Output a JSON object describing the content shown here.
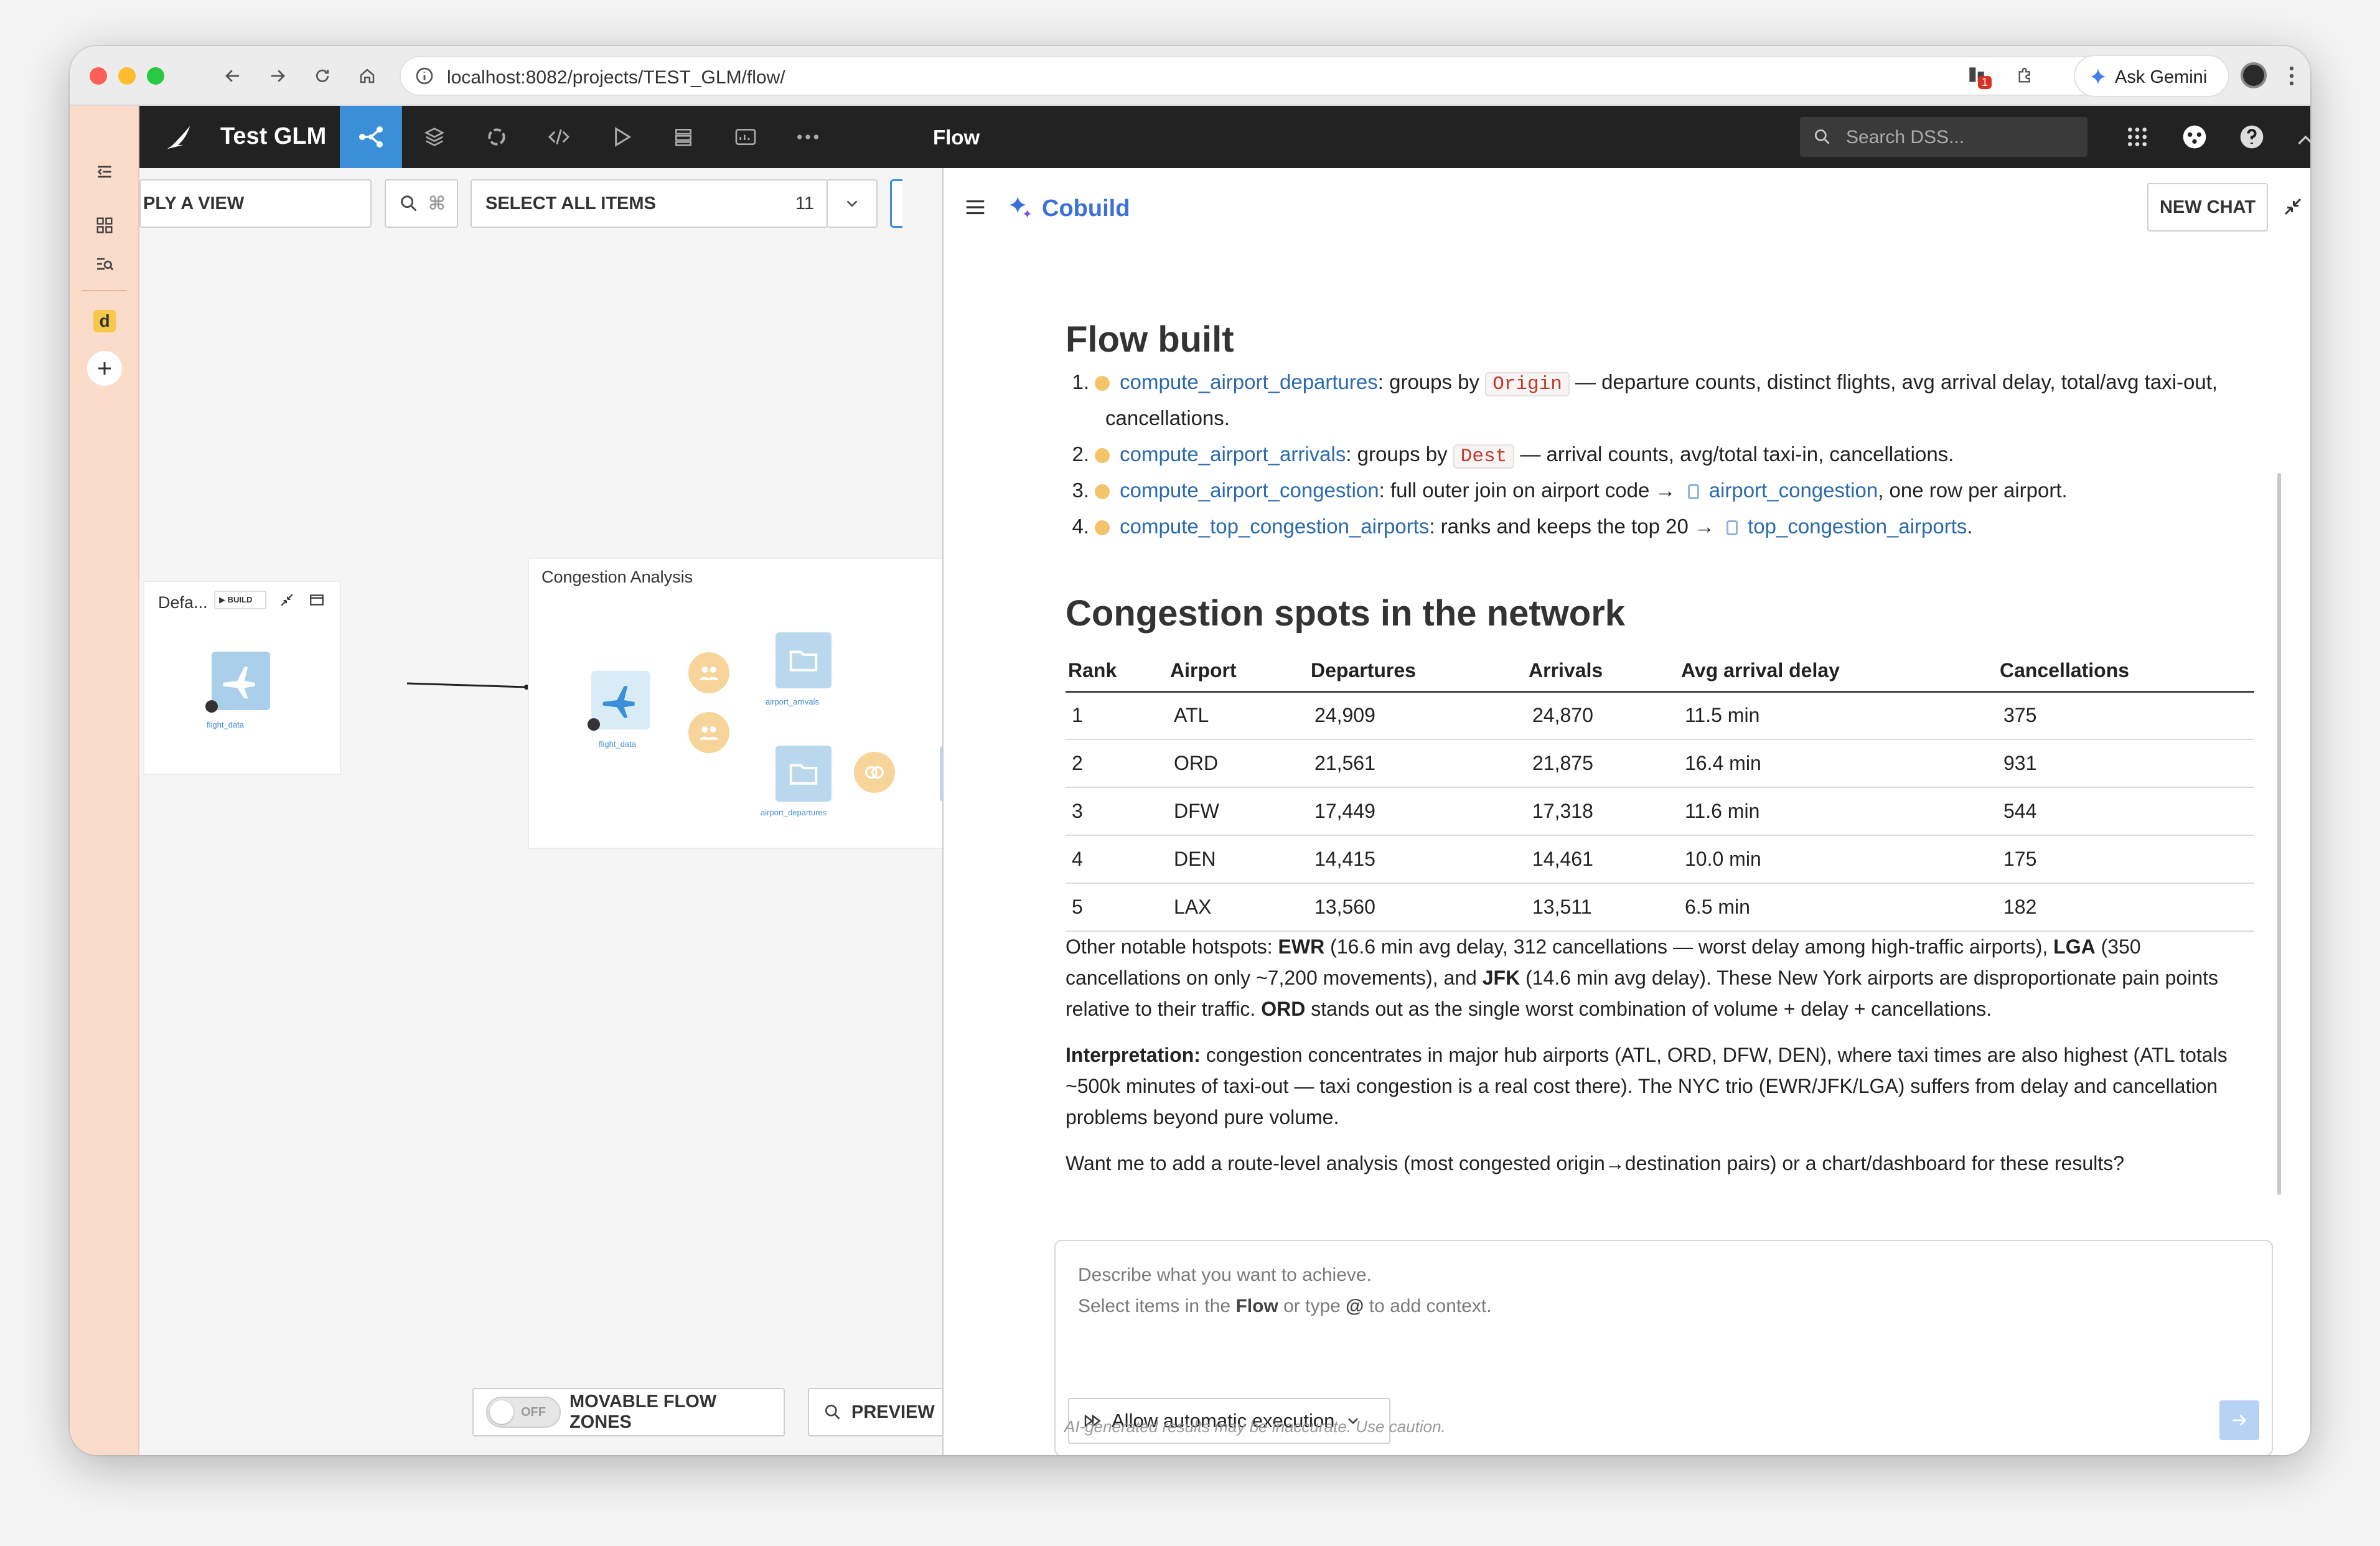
{
  "browser": {
    "url": "localhost:8082/projects/TEST_GLM/flow/",
    "gemini_label": "Ask Gemini",
    "badge": "1"
  },
  "appbar": {
    "project": "Test GLM",
    "section": "Flow",
    "search_placeholder": "Search DSS..."
  },
  "flow": {
    "view_label": "PLY A VIEW",
    "select_all_label": "SELECT ALL ITEMS",
    "select_all_count": "11",
    "zone_default_title": "Defa...",
    "zone_build_label": "BUILD",
    "zone_congestion_title": "Congestion Analysis",
    "node_flight_data_1": "flight_data",
    "node_flight_data_2": "flight_data",
    "node_airport_arrivals": "airport_arrivals",
    "node_airport_departures": "airport_departures",
    "toggle_state": "OFF",
    "movable_label": "MOVABLE FLOW ZONES",
    "preview_label": "PREVIEW"
  },
  "cobuild": {
    "title": "Cobuild",
    "new_chat": "NEW CHAT",
    "heading1": "Flow built",
    "steps": [
      {
        "num": "1.",
        "link": "compute_airport_departures",
        "pre": ": groups by ",
        "code": "Origin",
        "post": " — departure counts, distinct flights, avg arrival delay, total/avg taxi-out,",
        "cont": "cancellations."
      },
      {
        "num": "2.",
        "link": "compute_airport_arrivals",
        "pre": ": groups by ",
        "code": "Dest",
        "post": " — arrival counts, avg/total taxi-in, cancellations."
      },
      {
        "num": "3.",
        "link": "compute_airport_congestion",
        "pre": ": full outer join on airport code → ",
        "target": "airport_congestion",
        "post": ", one row per airport."
      },
      {
        "num": "4.",
        "link": "compute_top_congestion_airports",
        "pre": ": ranks and keeps the top 20 → ",
        "target": "top_congestion_airports",
        "post": "."
      }
    ],
    "heading2": "Congestion spots in the network",
    "table": {
      "headers": [
        "Rank",
        "Airport",
        "Departures",
        "Arrivals",
        "Avg arrival delay",
        "Cancellations"
      ],
      "rows": [
        [
          "1",
          "ATL",
          "24,909",
          "24,870",
          "11.5 min",
          "375"
        ],
        [
          "2",
          "ORD",
          "21,561",
          "21,875",
          "16.4 min",
          "931"
        ],
        [
          "3",
          "DFW",
          "17,449",
          "17,318",
          "11.6 min",
          "544"
        ],
        [
          "4",
          "DEN",
          "14,415",
          "14,461",
          "10.0 min",
          "175"
        ],
        [
          "5",
          "LAX",
          "13,560",
          "13,511",
          "6.5 min",
          "182"
        ]
      ]
    },
    "p1": {
      "a": "Other notable hotspots: ",
      "ewr": "EWR",
      "b": " (16.6 min avg delay, 312 cancellations — worst delay among high-traffic airports), ",
      "lga": "LGA",
      "c": " (350 cancellations on only ~7,200 movements), and ",
      "jfk": "JFK",
      "d": " (14.6 min avg delay). These New York airports are disproportionate pain points relative to their traffic. ",
      "ord": "ORD",
      "e": " stands out as the single worst combination of volume + delay + cancellations."
    },
    "p2": {
      "label": "Interpretation:",
      "text": " congestion concentrates in major hub airports (ATL, ORD, DFW, DEN), where taxi times are also highest (ATL totals ~500k minutes of taxi-out — taxi congestion is a real cost there). The NYC trio (EWR/JFK/LGA) suffers from delay and cancellation problems beyond pure volume."
    },
    "p3": "Want me to add a route-level analysis (most congested origin→destination pairs) or a chart/dashboard for these results?",
    "input": {
      "line1": "Describe what you want to achieve.",
      "line2a": "Select items in the ",
      "line2b": "Flow",
      "line2c": " or type ",
      "line2d": "@",
      "line2e": " to add context."
    },
    "exec_label": "Allow automatic execution",
    "disclaimer": "AI-generated results may be inaccurate. Use caution."
  }
}
